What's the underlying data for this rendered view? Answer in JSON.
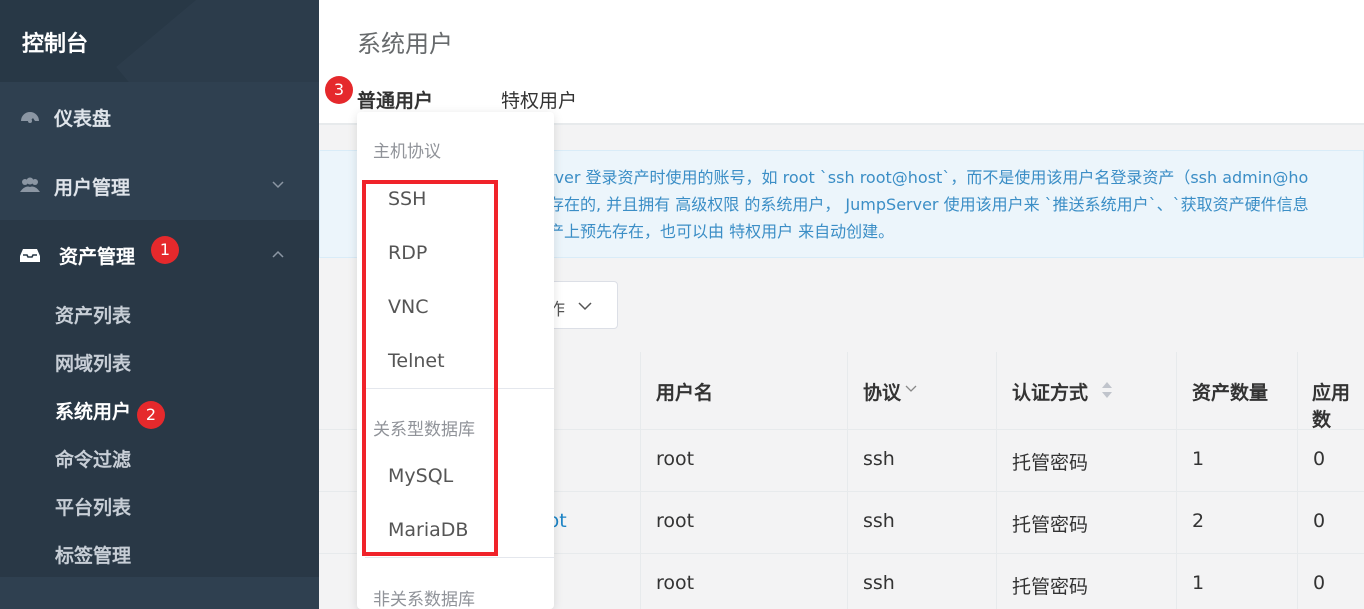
{
  "sidebar": {
    "title": "控制台",
    "menu": [
      {
        "label": "仪表盘",
        "icon": "dashboard-icon"
      },
      {
        "label": "用户管理",
        "icon": "users-icon"
      },
      {
        "label": "资产管理",
        "icon": "inbox-icon"
      }
    ],
    "asset_submenu": [
      "资产列表",
      "网域列表",
      "系统用户",
      "命令过滤",
      "平台列表",
      "标签管理"
    ]
  },
  "badges": {
    "b1": "1",
    "b2": "2",
    "b3": "3"
  },
  "page": {
    "title": "系统用户",
    "tabs": [
      "普通用户",
      "特权用户"
    ]
  },
  "info": {
    "line1": "rver 登录资产时使用的账号，如 root `ssh root@host`，而不是使用该用户名登录资产（ssh admin@ho",
    "line2": "存在的, 并且拥有 高级权限 的系统用户， JumpServer 使用该用户来 `推送系统用户`、`获取资产硬件信息",
    "line3": "产上预先存在，也可以由 特权用户 来自动创建。"
  },
  "action_button": "作",
  "table": {
    "headers": [
      "用户名",
      "协议",
      "认证方式",
      "资产数量",
      "应用数"
    ],
    "rows": [
      {
        "name_fragment": "",
        "username": "root",
        "protocol": "ssh",
        "auth": "托管密码",
        "assets": "1",
        "apps": "0"
      },
      {
        "name_fragment": "oot",
        "username": "root",
        "protocol": "ssh",
        "auth": "托管密码",
        "assets": "2",
        "apps": "0"
      },
      {
        "name_fragment": "",
        "username": "root",
        "protocol": "ssh",
        "auth": "托管密码",
        "assets": "1",
        "apps": "0"
      }
    ]
  },
  "dropdown": {
    "group_host": "主机协议",
    "host_items": [
      "SSH",
      "RDP",
      "VNC",
      "Telnet"
    ],
    "group_rdb": "关系型数据库",
    "rdb_items": [
      "MySQL",
      "MariaDB"
    ],
    "group_nosql": "非关系数据库"
  },
  "colors": {
    "sidebar": "#2f4050",
    "badge": "#e5292c",
    "highlight_box": "#f0232a",
    "link": "#1c84c6"
  }
}
